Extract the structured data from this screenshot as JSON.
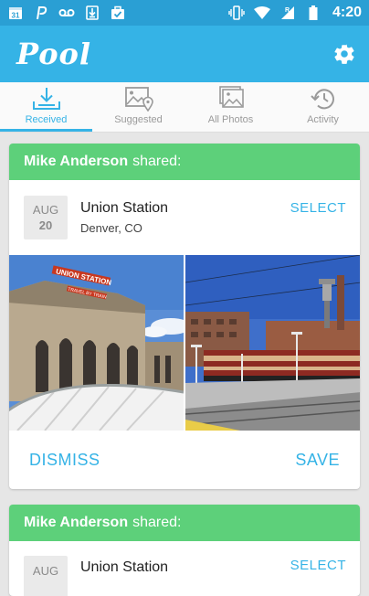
{
  "status_bar": {
    "time": "4:20",
    "calendar_date": "31",
    "left_icons": [
      "calendar-icon",
      "p-icon",
      "voicemail-icon",
      "download-icon",
      "briefcase-check-icon"
    ],
    "right_icons": [
      "vibrate-icon",
      "wifi-icon",
      "signal-icon",
      "battery-icon"
    ],
    "signal_badge": "R",
    "bg_color": "#2a9fd4"
  },
  "app_bar": {
    "logo": "Pool",
    "bg_color": "#35b3e6",
    "settings_icon": "gear-icon"
  },
  "tabs": [
    {
      "label": "Received",
      "icon": "inbox-download-icon",
      "active": true
    },
    {
      "label": "Suggested",
      "icon": "image-pin-icon",
      "active": false
    },
    {
      "label": "All Photos",
      "icon": "photo-stack-icon",
      "active": false
    },
    {
      "label": "Activity",
      "icon": "history-icon",
      "active": false
    }
  ],
  "cards": [
    {
      "sharer": "Mike Anderson",
      "shared_text": "shared:",
      "date_month": "AUG",
      "date_day": "20",
      "title": "Union Station",
      "location": "Denver, CO",
      "select_label": "SELECT",
      "dismiss_label": "DISMISS",
      "save_label": "SAVE",
      "photo_sign_text": "UNION STATION",
      "photo_sign_sub": "TRAVEL BY TRAIN"
    },
    {
      "sharer": "Mike Anderson",
      "shared_text": "shared:",
      "date_month": "AUG",
      "title": "Union Station",
      "select_label": "SELECT"
    }
  ],
  "colors": {
    "accent": "#35b3e6",
    "card_header": "#5dd07a",
    "background": "#e6e6e6"
  }
}
